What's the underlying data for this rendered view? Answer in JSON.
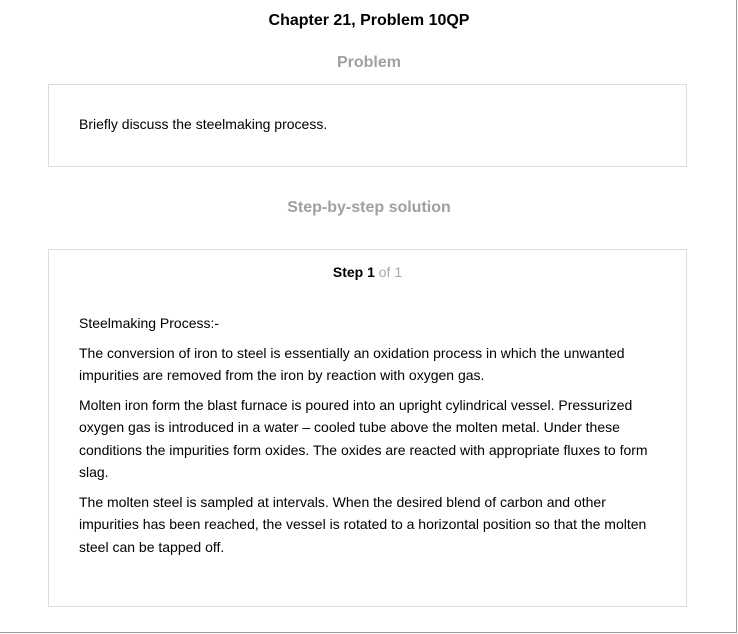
{
  "header": {
    "chapter_title": "Chapter 21, Problem 10QP"
  },
  "problem": {
    "section_title": "Problem",
    "text": "Briefly discuss the steelmaking process."
  },
  "solution": {
    "section_title": "Step-by-step solution",
    "step": {
      "label": "Step 1",
      "total": "of 1",
      "paragraphs": [
        "Steelmaking Process:-",
        "The conversion of iron to steel is essentially an oxidation process in which the unwanted impurities are removed from the iron by reaction with oxygen gas.",
        "Molten iron form the blast furnace is poured into an upright cylindrical vessel. Pressurized oxygen gas is introduced in a water – cooled tube above the molten metal. Under these conditions the impurities form oxides. The oxides are reacted with appropriate fluxes to form slag.",
        "The molten steel is sampled at intervals. When the desired blend of carbon and other impurities has been reached, the vessel is rotated to a horizontal position so that the molten steel can be tapped off."
      ]
    }
  }
}
